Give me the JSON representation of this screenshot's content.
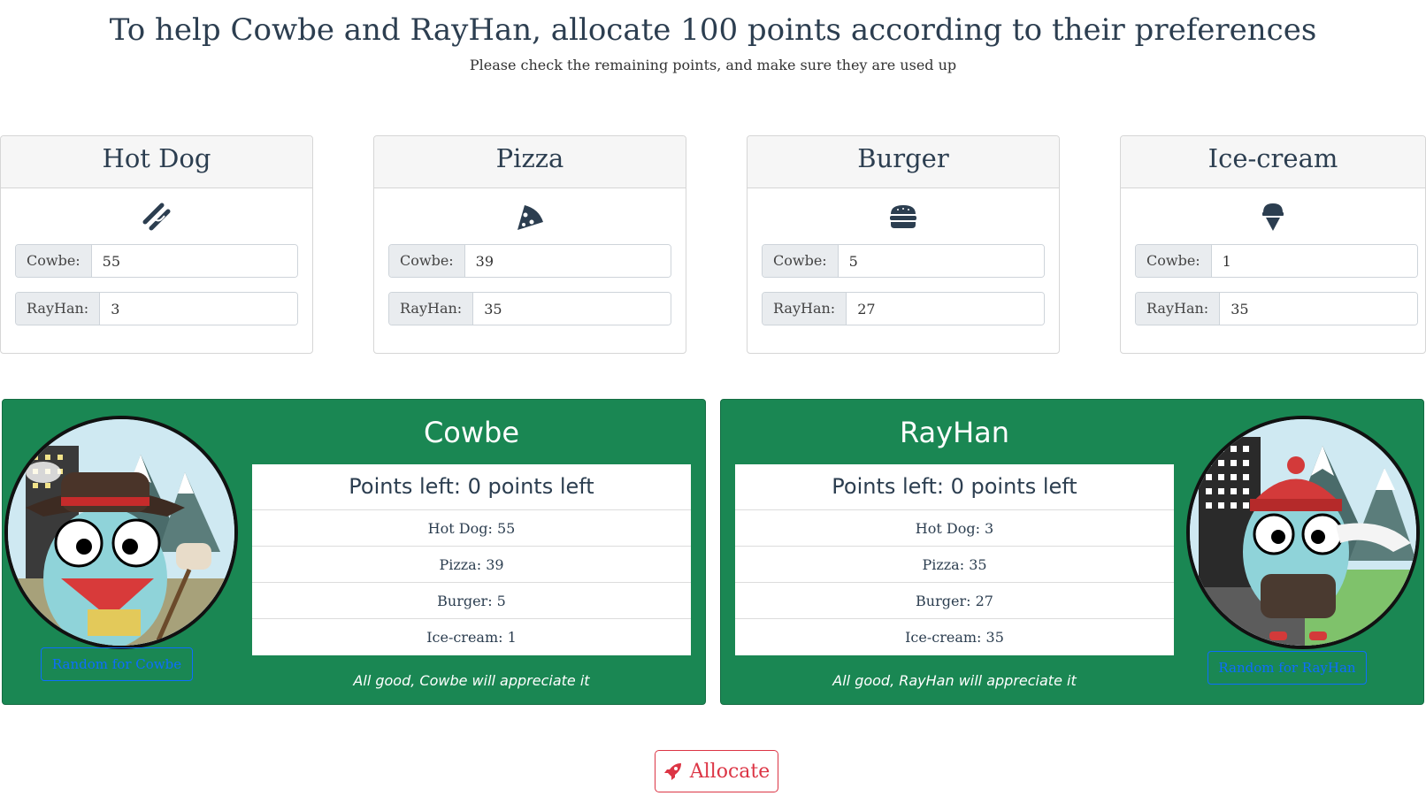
{
  "header": {
    "title": "To help Cowbe and RayHan, allocate 100 points according to their preferences",
    "subtitle": "Please check the remaining points, and make sure they are used up"
  },
  "items": [
    {
      "name": "Hot Dog",
      "icon": "hotdog-icon",
      "cowbe_label": "Cowbe:",
      "cowbe_value": "55",
      "rayhan_label": "RayHan:",
      "rayhan_value": "3"
    },
    {
      "name": "Pizza",
      "icon": "pizza-icon",
      "cowbe_label": "Cowbe:",
      "cowbe_value": "39",
      "rayhan_label": "RayHan:",
      "rayhan_value": "35"
    },
    {
      "name": "Burger",
      "icon": "burger-icon",
      "cowbe_label": "Cowbe:",
      "cowbe_value": "5",
      "rayhan_label": "RayHan:",
      "rayhan_value": "27"
    },
    {
      "name": "Ice-cream",
      "icon": "ice-cream-icon",
      "cowbe_label": "Cowbe:",
      "cowbe_value": "1",
      "rayhan_label": "RayHan:",
      "rayhan_value": "35"
    }
  ],
  "players": [
    {
      "name": "Cowbe",
      "points_left": "Points left: 0 points left",
      "lines": [
        "Hot Dog: 55",
        "Pizza: 39",
        "Burger: 5",
        "Ice-cream: 1"
      ],
      "status": "All good, Cowbe will appreciate it",
      "random_label": "Random for Cowbe",
      "avatar_icon": "cowboy-gopher-icon"
    },
    {
      "name": "RayHan",
      "points_left": "Points left: 0 points left",
      "lines": [
        "Hot Dog: 3",
        "Pizza: 35",
        "Burger: 27",
        "Ice-cream: 35"
      ],
      "status": "All good, RayHan will appreciate it",
      "random_label": "Random for RayHan",
      "avatar_icon": "winter-gopher-icon"
    }
  ],
  "actions": {
    "allocate_label": "Allocate",
    "allocate_icon": "rocket-icon"
  },
  "colors": {
    "panel_green": "#1a8753",
    "allocate_red": "#dc3545",
    "random_blue": "#0d6efd",
    "heading": "#2c3e50"
  }
}
